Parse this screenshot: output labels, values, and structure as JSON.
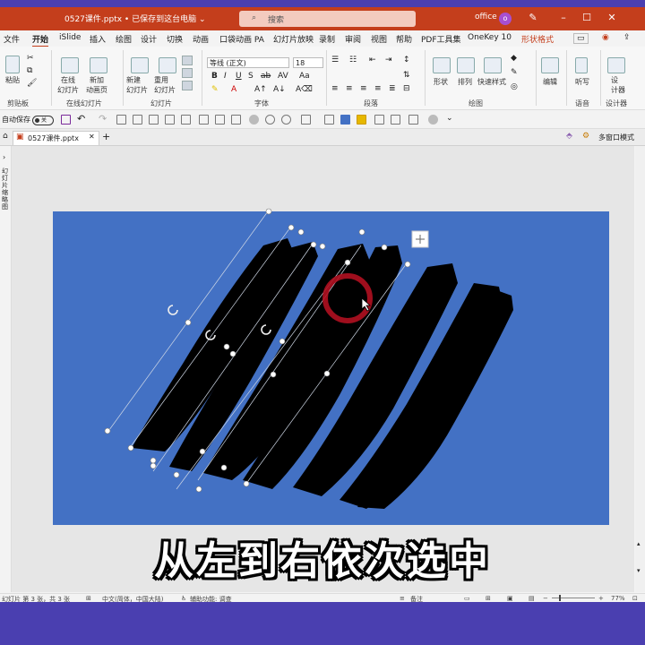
{
  "titlebar": {
    "filename": "0527课件.pptx • 已保存到这台电脑 ⌄",
    "search_placeholder": "搜索",
    "user": "office",
    "avatar_initial": "o",
    "accent_color": "#c43e1c"
  },
  "menu_tabs": [
    "文件",
    "开始",
    "iSlide",
    "插入",
    "绘图",
    "设计",
    "切换",
    "动画",
    "口袋动画 PA",
    "幻灯片放映",
    "录制",
    "审阅",
    "视图",
    "帮助",
    "PDF工具集",
    "OneKey 10",
    "形状格式"
  ],
  "ribbon": {
    "clipboard": {
      "paste_label": "粘贴",
      "group_label": "剪贴板"
    },
    "online_slides": {
      "btn1": "在线\n幻灯片",
      "btn2": "新加\n动画页",
      "group_label": "在线幻灯片"
    },
    "slides": {
      "new_slide": "新建\n幻灯片",
      "reuse_slide": "重用\n幻灯片",
      "group_label": "幻灯片"
    },
    "font": {
      "font_name": "等线 (正文)",
      "font_size": "18",
      "group_label": "字体"
    },
    "paragraph": {
      "group_label": "段落"
    },
    "drawing": {
      "shape": "形状",
      "arrange": "排列",
      "quick_styles": "快速样式",
      "group_label": "绘图"
    },
    "editing": {
      "label": "编辑"
    },
    "voice": {
      "dictate": "听写",
      "group_label": "语音"
    },
    "designer": {
      "label": "设\n计器",
      "group_label": "设计器"
    }
  },
  "qat": {
    "autosave_label": "自动保存",
    "autosave_state": "关"
  },
  "doc_tabs": {
    "file_tab": "0527课件.pptx",
    "multi_window": "多窗口模式"
  },
  "left_pane_label": "幻灯片缩略图",
  "status": {
    "slide_info": "幻灯片 第 3 张，共 3 张",
    "language": "中文(简体，中国大陆)",
    "accessibility": "辅助功能: 调查",
    "notes": "备注",
    "zoom": "77%"
  },
  "slide": {
    "background": "#4371c4",
    "stroke_color": "#000000"
  },
  "caption": "从左到右依次选中"
}
